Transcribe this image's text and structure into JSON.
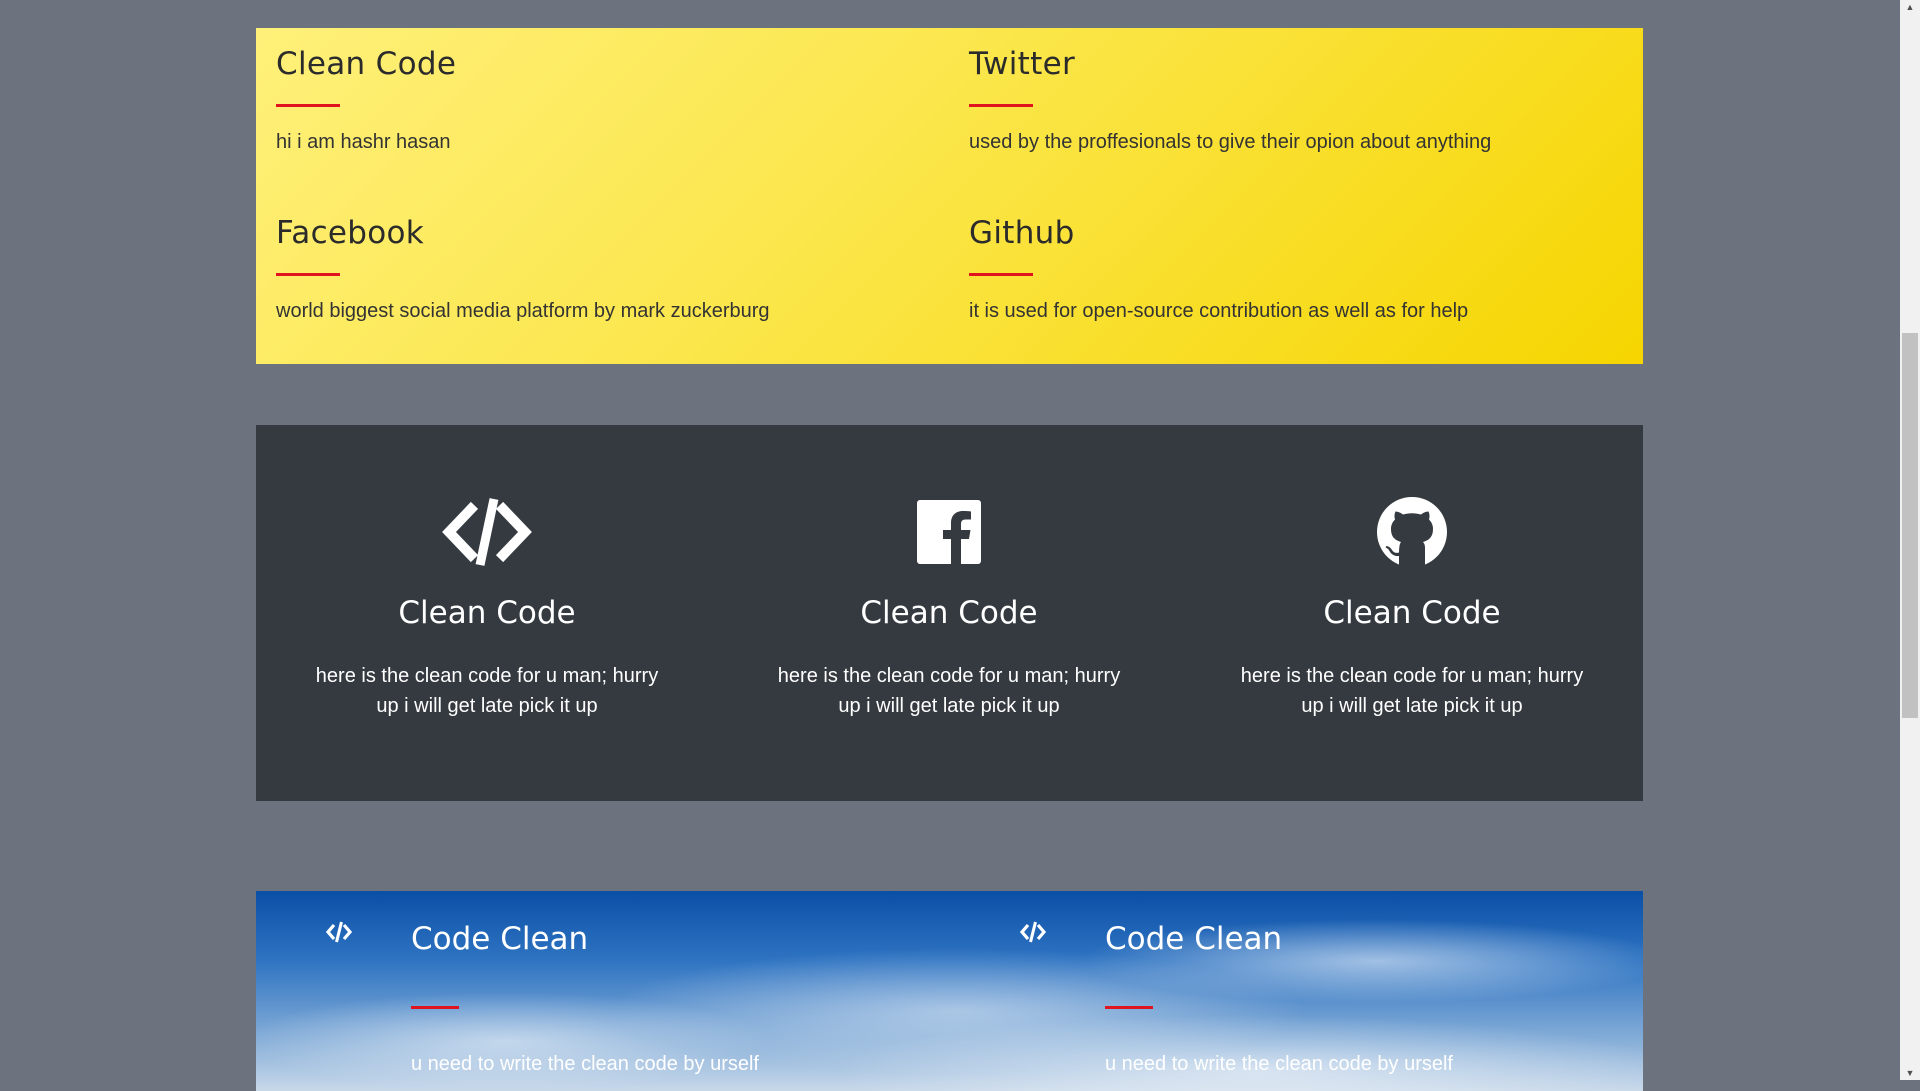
{
  "yellow_section": {
    "items": [
      {
        "title": "Clean Code",
        "text": "hi i am hashr hasan"
      },
      {
        "title": "Twitter",
        "text": "used by the proffesionals to give their opion about anything"
      },
      {
        "title": "Facebook",
        "text": "world biggest social media platform by mark zuckerburg"
      },
      {
        "title": "Github",
        "text": "it is used for open-source contribution as well as for help"
      }
    ],
    "accent": "#e0141e"
  },
  "feature_section": {
    "items": [
      {
        "icon": "code-icon",
        "title": "Clean Code",
        "text": "here is the clean code for u man; hurry up i will get late pick it up"
      },
      {
        "icon": "facebook-icon",
        "title": "Clean Code",
        "text": "here is the clean code for u man; hurry up i will get late pick it up"
      },
      {
        "icon": "github-icon",
        "title": "Clean Code",
        "text": "here is the clean code for u man; hurry up i will get late pick it up"
      }
    ]
  },
  "sky_section": {
    "items": [
      {
        "icon": "code-icon",
        "title": "Code Clean",
        "text": "u need to write the clean code by urself"
      },
      {
        "icon": "code-icon",
        "title": "Code Clean",
        "text": "u need to write the clean code by urself"
      }
    ]
  },
  "colors": {
    "page_bg": "#6c737e",
    "yellow_start": "#fff07a",
    "yellow_end": "#f6d500",
    "dark_bg": "#343a40"
  },
  "scrollbar": {
    "up_arrow": "▲",
    "down_arrow": "▼"
  }
}
